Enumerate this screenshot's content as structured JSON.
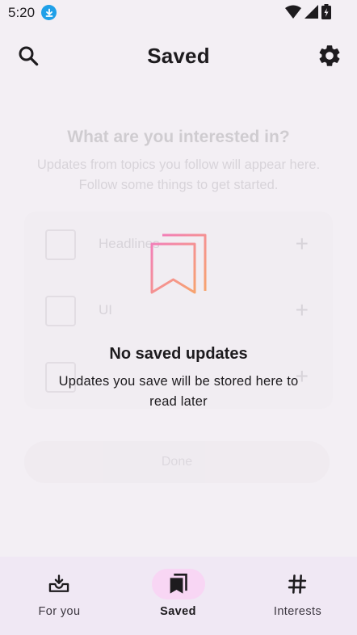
{
  "status_bar": {
    "time": "5:20"
  },
  "top_bar": {
    "title": "Saved"
  },
  "background": {
    "heading": "What are you interested in?",
    "subtitle": "Updates from topics you follow will appear here. Follow some things to get started.",
    "topics": [
      {
        "label": "Headlines"
      },
      {
        "label": "UI"
      },
      {
        "label": ""
      }
    ],
    "done_label": "Done"
  },
  "empty_state": {
    "title": "No saved updates",
    "description": "Updates you save will be stored here to read later"
  },
  "bottom_nav": {
    "items": [
      {
        "label": "For you",
        "icon": "inbox-icon"
      },
      {
        "label": "Saved",
        "icon": "bookmarks-icon"
      },
      {
        "label": "Interests",
        "icon": "hashtag-icon"
      }
    ],
    "selected": "Saved"
  },
  "colors": {
    "background": "#f3eff4",
    "nav_background": "#f0e8f4",
    "nav_active_pill": "#f8d6f4",
    "icon_gradient_start": "#f27fb8",
    "icon_gradient_end": "#f7a36e",
    "download_badge": "#1fa0e8"
  }
}
